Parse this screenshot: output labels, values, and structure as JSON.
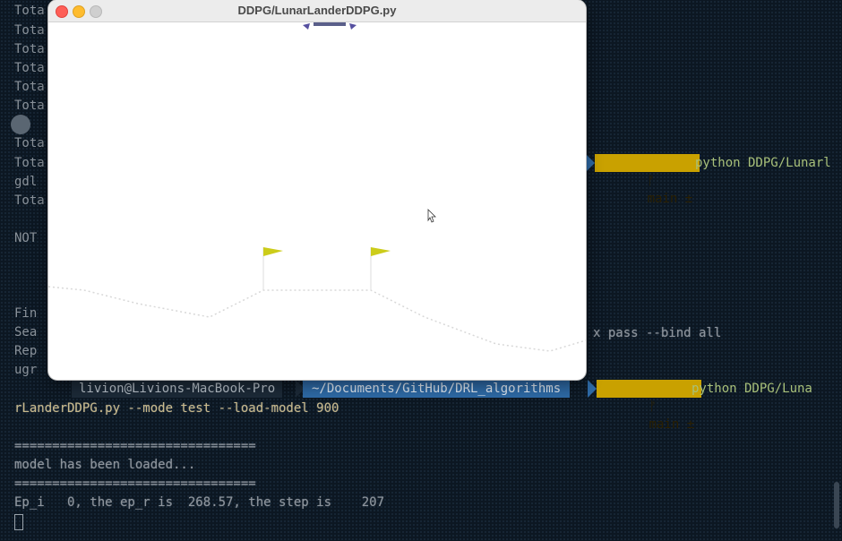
{
  "window": {
    "title": "DDPG/LunarLanderDDPG.py"
  },
  "terminal": {
    "left_fragments": [
      "Tota",
      "Tota",
      "Tota",
      "Tota",
      "Tota",
      "Tota",
      "",
      "Tota",
      "Tota",
      "gdl",
      "Tota",
      "",
      "NOT",
      "",
      "",
      "Fin",
      "Sea",
      "Rep",
      "ugr"
    ],
    "right_text_1": "x pass --bind all",
    "prompt_1": {
      "git": "main ±",
      "cmd": "python DDPG/Lunarl"
    },
    "prompt_2": {
      "user": "livion@Livions-MacBook-Pro",
      "path": "~/Documents/GitHub/DRL_algorithms",
      "git": "main ±",
      "cmd": "python DDPG/Luna"
    },
    "lines": [
      "rLanderDDPG.py --mode test --load-model 900",
      "",
      "================================",
      "model has been loaded...",
      "================================",
      "Ep_i   0, the ep_r is  268.57, the step is    207"
    ],
    "cursor": "█"
  },
  "icons": {
    "branch": "branch-icon"
  }
}
